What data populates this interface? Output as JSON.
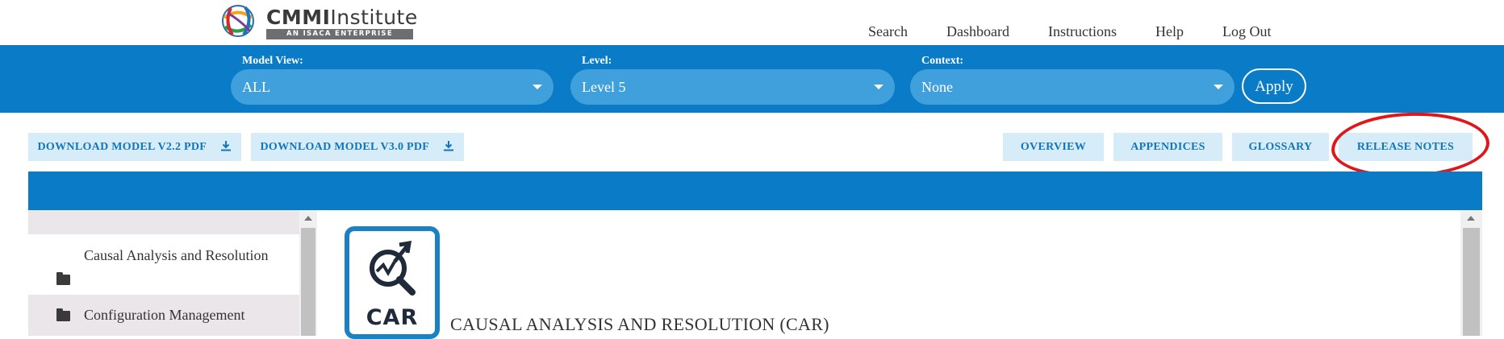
{
  "header": {
    "logo": {
      "word_bold": "CMMI",
      "word_thin": "Institute",
      "tagline": "AN ISACA ENTERPRISE"
    },
    "nav": [
      "Search",
      "Dashboard",
      "Instructions",
      "Help",
      "Log Out"
    ]
  },
  "filters": {
    "model_view": {
      "label": "Model View:",
      "value": "ALL"
    },
    "level": {
      "label": "Level:",
      "value": "Level 5"
    },
    "context": {
      "label": "Context:",
      "value": "None"
    },
    "apply_label": "Apply"
  },
  "actions": {
    "download_v22": "DOWNLOAD MODEL V2.2 PDF",
    "download_v30": "DOWNLOAD MODEL V3.0 PDF",
    "overview": "OVERVIEW",
    "appendices": "APPENDICES",
    "glossary": "GLOSSARY",
    "release_notes": "RELEASE NOTES"
  },
  "sidebar": {
    "items": [
      {
        "label": "Causal Analysis and Resolution"
      },
      {
        "label": "Configuration Management"
      }
    ]
  },
  "main": {
    "icon_label": "CAR",
    "title": "CAUSAL ANALYSIS AND RESOLUTION (CAR)"
  },
  "colors": {
    "brand_blue": "#0a7cc7",
    "select_blue": "#40a0db",
    "button_light": "#d6ecf9",
    "annotation_red": "#e0161b"
  }
}
